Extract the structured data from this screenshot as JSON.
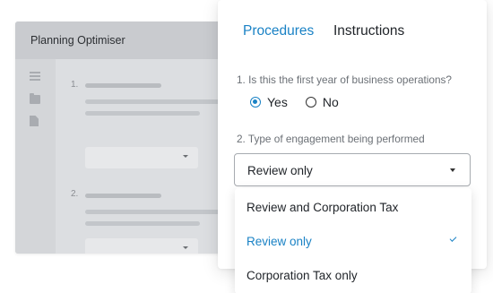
{
  "background_window": {
    "title": "Planning Optimiser",
    "items": [
      {
        "number": "1."
      },
      {
        "number": "2."
      }
    ]
  },
  "card": {
    "tabs": [
      {
        "label": "Procedures",
        "active": true
      },
      {
        "label": "Instructions",
        "active": false
      }
    ],
    "question1": {
      "text": "1. Is this the first year of business operations?",
      "options": [
        {
          "label": "Yes",
          "selected": true
        },
        {
          "label": "No",
          "selected": false
        }
      ]
    },
    "question2": {
      "text": "2. Type of engagement being performed",
      "selected_value": "Review only"
    }
  },
  "dropdown": {
    "options": [
      {
        "label": "Review and Corporation Tax",
        "selected": false
      },
      {
        "label": "Review only",
        "selected": true
      },
      {
        "label": "Corporation Tax only",
        "selected": false
      }
    ]
  },
  "colors": {
    "accent": "#1a82c5",
    "text": "#1f2328",
    "muted": "#6b7076"
  }
}
